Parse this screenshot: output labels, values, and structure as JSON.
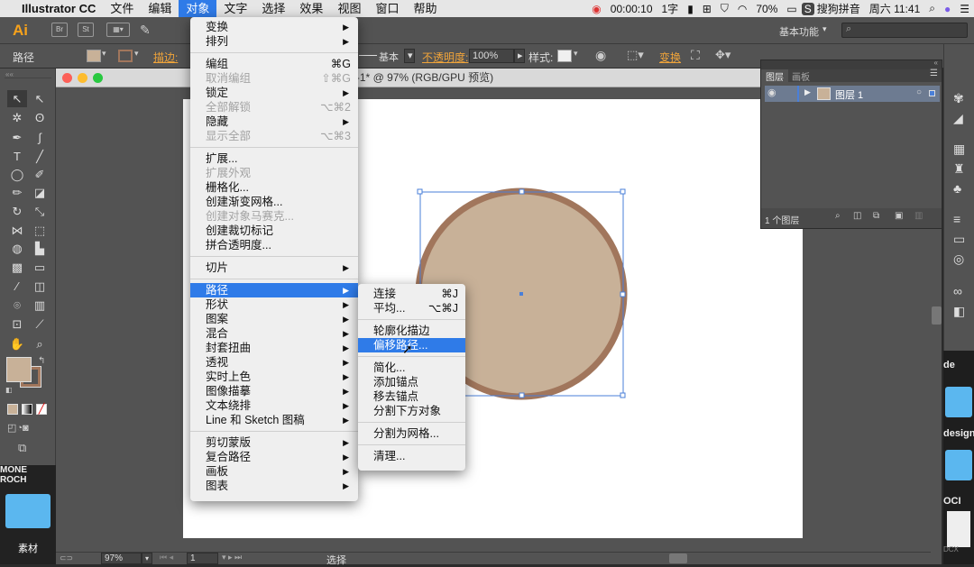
{
  "menubar": {
    "app": "Illustrator CC",
    "items": [
      "文件",
      "编辑",
      "对象",
      "文字",
      "选择",
      "效果",
      "视图",
      "窗口",
      "帮助"
    ],
    "active": "对象",
    "timer": "00:00:10",
    "chars": "1字",
    "battery": "70%",
    "ime": "搜狗拼音",
    "datetime": "周六 11:41"
  },
  "appbar": {
    "logo": "Ai",
    "workspace": "基本功能"
  },
  "control": {
    "label": "路径",
    "stroke_label": "描边:",
    "stroke_style": "基本",
    "opacity_label": "不透明度:",
    "opacity_value": "100%",
    "style_label": "样式:",
    "transform_label": "变换"
  },
  "doc": {
    "title": "未标题-1* @ 97% (RGB/GPU 预览)"
  },
  "layers": {
    "tab1": "图层",
    "tab2": "画板",
    "layer_name": "图层 1",
    "count": "1 个图层"
  },
  "status": {
    "zoom": "97%",
    "page": "1",
    "tool": "选择"
  },
  "object_menu": {
    "groups": [
      [
        {
          "label": "变换",
          "sub": true
        },
        {
          "label": "排列",
          "sub": true
        }
      ],
      [
        {
          "label": "编组",
          "sc": "⌘G"
        },
        {
          "label": "取消编组",
          "sc": "⇧⌘G",
          "dis": true
        },
        {
          "label": "锁定",
          "sub": true
        },
        {
          "label": "全部解锁",
          "sc": "⌥⌘2",
          "dis": true
        },
        {
          "label": "隐藏",
          "sub": true
        },
        {
          "label": "显示全部",
          "sc": "⌥⌘3",
          "dis": true
        }
      ],
      [
        {
          "label": "扩展..."
        },
        {
          "label": "扩展外观",
          "dis": true
        },
        {
          "label": "栅格化..."
        },
        {
          "label": "创建渐变网格..."
        },
        {
          "label": "创建对象马赛克...",
          "dis": true
        },
        {
          "label": "创建裁切标记"
        },
        {
          "label": "拼合透明度..."
        }
      ],
      [
        {
          "label": "切片",
          "sub": true
        }
      ],
      [
        {
          "label": "路径",
          "sub": true,
          "hl": true
        },
        {
          "label": "形状",
          "sub": true
        },
        {
          "label": "图案",
          "sub": true
        },
        {
          "label": "混合",
          "sub": true
        },
        {
          "label": "封套扭曲",
          "sub": true
        },
        {
          "label": "透视",
          "sub": true
        },
        {
          "label": "实时上色",
          "sub": true
        },
        {
          "label": "图像描摹",
          "sub": true
        },
        {
          "label": "文本绕排",
          "sub": true
        },
        {
          "label": "Line 和 Sketch 图稿",
          "sub": true
        }
      ],
      [
        {
          "label": "剪切蒙版",
          "sub": true
        },
        {
          "label": "复合路径",
          "sub": true
        },
        {
          "label": "画板",
          "sub": true
        },
        {
          "label": "图表",
          "sub": true
        }
      ]
    ]
  },
  "path_menu": {
    "groups": [
      [
        {
          "label": "连接",
          "sc": "⌘J"
        },
        {
          "label": "平均...",
          "sc": "⌥⌘J"
        }
      ],
      [
        {
          "label": "轮廓化描边"
        },
        {
          "label": "偏移路径...",
          "hl": true
        }
      ],
      [
        {
          "label": "简化..."
        },
        {
          "label": "添加锚点"
        },
        {
          "label": "移去锚点"
        },
        {
          "label": "分割下方对象"
        }
      ],
      [
        {
          "label": "分割为网格..."
        }
      ],
      [
        {
          "label": "清理..."
        }
      ]
    ]
  },
  "desktop": {
    "folder_label": "素材",
    "left_text": "MONE ROCH",
    "r1": "de",
    "r2": "design",
    "r3": "OCI",
    "r4": "DCX"
  },
  "colors": {
    "fill": "#c8b198",
    "stroke": "#a1765c",
    "accent": "#2f7be8",
    "selection": "#4a7fd8"
  }
}
